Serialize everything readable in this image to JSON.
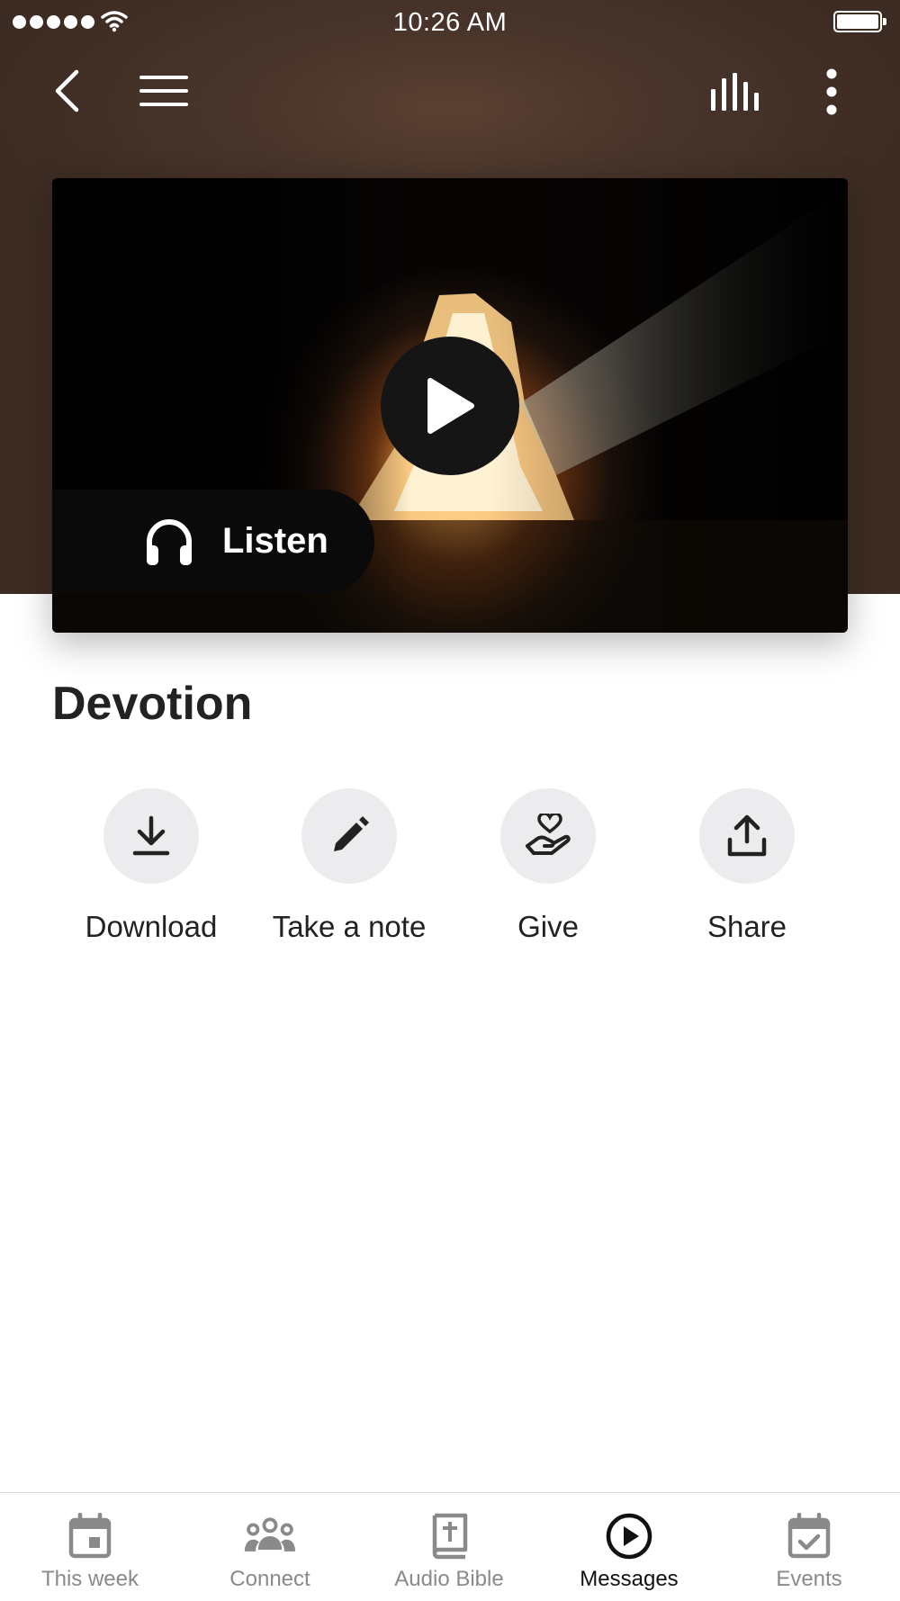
{
  "status_bar": {
    "time": "10:26 AM"
  },
  "header": {
    "back_icon": "chevron-left-icon",
    "menu_icon": "hamburger-menu-icon",
    "equalizer_icon": "audio-bars-icon",
    "more_icon": "vertical-dots-icon",
    "background_color": "#48342a"
  },
  "media": {
    "thumbnail": "tomb-light-image",
    "play_icon": "play-icon",
    "listen_label": "Listen",
    "listen_icon": "headphones-icon"
  },
  "content": {
    "title": "Devotion"
  },
  "actions": [
    {
      "label": "Download",
      "icon": "download-icon"
    },
    {
      "label": "Take a note",
      "icon": "pencil-icon"
    },
    {
      "label": "Give",
      "icon": "give-heart-hand-icon"
    },
    {
      "label": "Share",
      "icon": "share-upload-icon"
    }
  ],
  "tab_bar": {
    "items": [
      {
        "label": "This week",
        "icon": "calendar-icon",
        "active": false
      },
      {
        "label": "Connect",
        "icon": "people-group-icon",
        "active": false
      },
      {
        "label": "Audio Bible",
        "icon": "bible-book-icon",
        "active": false
      },
      {
        "label": "Messages",
        "icon": "play-circle-icon",
        "active": true
      },
      {
        "label": "Events",
        "icon": "calendar-check-icon",
        "active": false
      }
    ],
    "active_color": "#111111",
    "inactive_color": "#8a8a8a"
  }
}
